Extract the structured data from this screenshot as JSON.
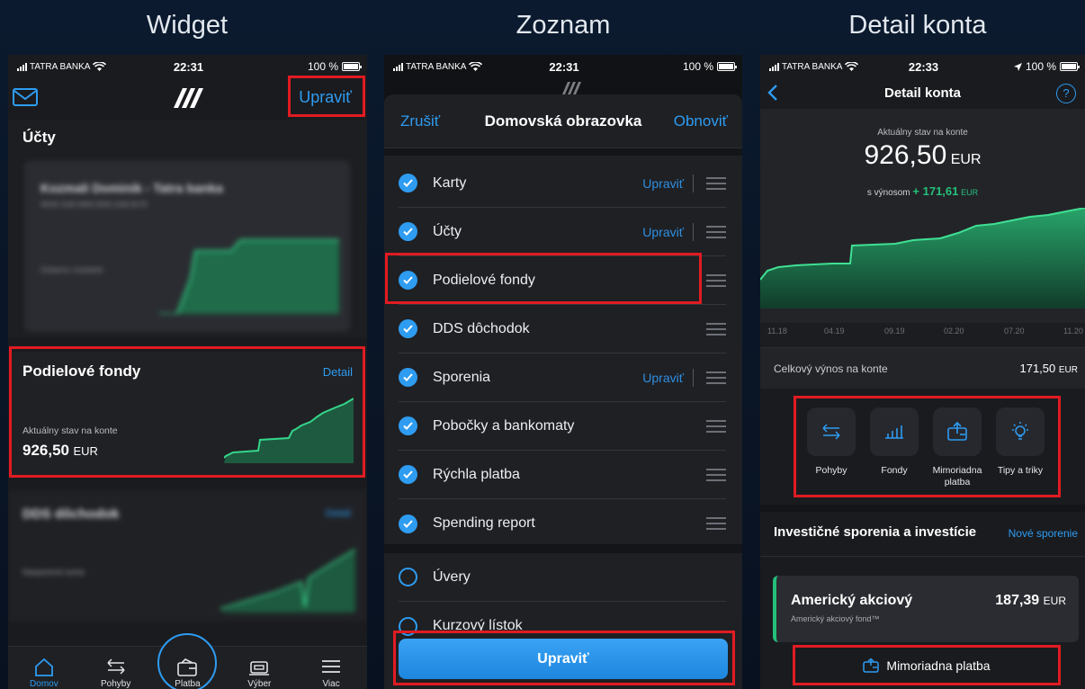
{
  "titles": {
    "left": "Widget",
    "middle": "Zoznam",
    "right": "Detail konta"
  },
  "status": {
    "carrier": "TATRA BANKA",
    "time1": "22:31",
    "time2": "22:31",
    "time3": "22:33",
    "battery": "100 %"
  },
  "p1": {
    "edit": "Upraviť",
    "accounts_heading": "Účty",
    "blur_account_name": "Kozmali Dominik - Tatra banka",
    "blur_account_iban": "SK44 1100 0000 0026 1160 8170",
    "blur_account_status": "Ostanov zostatok",
    "funds_title": "Podielové fondy",
    "funds_detail": "Detail",
    "funds_balance_label": "Aktuálny stav na konte",
    "funds_amount": "926,50",
    "funds_currency": "EUR",
    "dds_title": "DDS dôchodok",
    "dds_link": "Detail",
    "dds_sub": "Nasporená suma",
    "nav": [
      {
        "label": "Domov",
        "icon": "home-icon"
      },
      {
        "label": "Pohyby",
        "icon": "transfer-arrows-icon"
      },
      {
        "label": "Platba",
        "icon": "wallet-icon"
      },
      {
        "label": "Výber",
        "icon": "atm-icon"
      },
      {
        "label": "Viac",
        "icon": "menu-icon"
      }
    ]
  },
  "p2": {
    "cancel": "Zrušiť",
    "title": "Domovská obrazovka",
    "restore": "Obnoviť",
    "items": [
      {
        "label": "Karty",
        "edit": "Upraviť",
        "checked": true
      },
      {
        "label": "Účty",
        "edit": "Upraviť",
        "checked": true
      },
      {
        "label": "Podielové fondy",
        "edit": "",
        "checked": true
      },
      {
        "label": "DDS dôchodok",
        "edit": "",
        "checked": true
      },
      {
        "label": "Sporenia",
        "edit": "Upraviť",
        "checked": true
      },
      {
        "label": "Pobočky a bankomaty",
        "edit": "",
        "checked": true
      },
      {
        "label": "Rýchla platba",
        "edit": "",
        "checked": true
      },
      {
        "label": "Spending report",
        "edit": "",
        "checked": true
      },
      {
        "label": "Úvery",
        "edit": "",
        "checked": false
      },
      {
        "label": "Kurzový lístok",
        "edit": "",
        "checked": false
      }
    ],
    "bottom_button": "Upraviť"
  },
  "p3": {
    "title": "Detail konta",
    "balance_label": "Aktuálny stav na konte",
    "balance": "926,50",
    "currency": "EUR",
    "yield_label": "s výnosom",
    "yield_value": "+ 171,61",
    "yield_currency": "EUR",
    "x_ticks": [
      "11.18",
      "04.19",
      "09.19",
      "02.20",
      "07.20",
      "11.20"
    ],
    "total_yield_label": "Celkový výnos na konte",
    "total_yield_value": "171,50",
    "total_yield_currency": "EUR",
    "actions": [
      {
        "label": "Pohyby",
        "icon": "transfer-arrows-icon"
      },
      {
        "label": "Fondy",
        "icon": "bar-chart-icon"
      },
      {
        "label": "Mimoriadna platba",
        "icon": "wallet-icon"
      },
      {
        "label": "Tipy a triky",
        "icon": "lightbulb-icon"
      }
    ],
    "section_title": "Investičné sporenia a investície",
    "section_link": "Nové sporenie",
    "fund_name": "Americký akciový",
    "fund_sub": "Americký akciový fond™",
    "fund_amount": "187,39",
    "fund_currency": "EUR",
    "extra_payment": "Mimoriadna platba"
  },
  "colors": {
    "accent": "#2e9cf1",
    "highlight": "#e11b22",
    "green": "#24c07a",
    "panel": "#1a1b1f"
  }
}
